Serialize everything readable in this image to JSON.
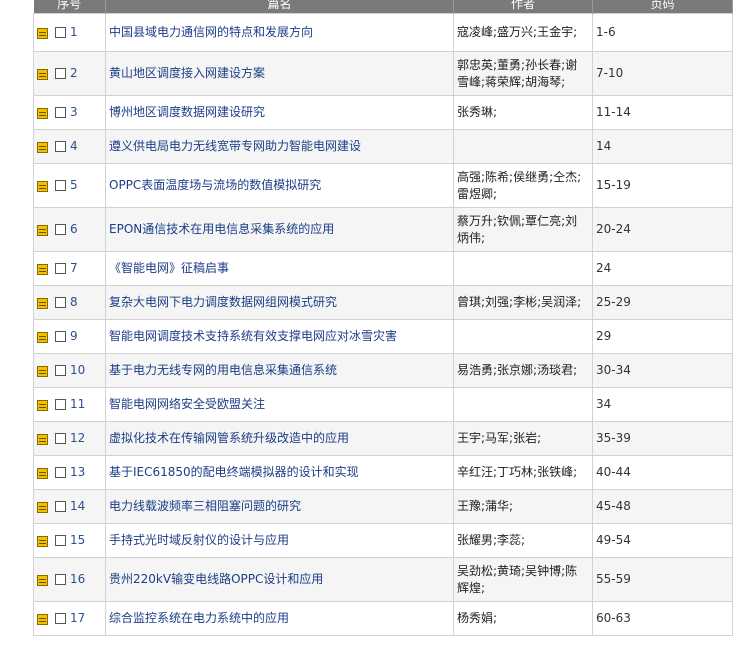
{
  "table": {
    "headers": [
      "序号",
      "篇名",
      "作者",
      "页码"
    ],
    "rows": [
      {
        "num": "1",
        "title": "中国县域电力通信网的特点和发展方向",
        "authors": "寇凌峰;盛万兴;王金宇;",
        "pages": "1-6"
      },
      {
        "num": "2",
        "title": "黄山地区调度接入网建设方案",
        "authors": "郭忠英;董勇;孙长春;谢雪峰;蒋荣辉;胡海琴;",
        "pages": "7-10"
      },
      {
        "num": "3",
        "title": "博州地区调度数据网建设研究",
        "authors": "张秀琳;",
        "pages": "11-14"
      },
      {
        "num": "4",
        "title": "遵义供电局电力无线宽带专网助力智能电网建设",
        "authors": "",
        "pages": "14"
      },
      {
        "num": "5",
        "title": "OPPC表面温度场与流场的数值模拟研究",
        "authors": "高强;陈希;侯继勇;仝杰;雷煜卿;",
        "pages": "15-19"
      },
      {
        "num": "6",
        "title": "EPON通信技术在用电信息采集系统的应用",
        "authors": "蔡万升;钦佩;覃仁亮;刘炳伟;",
        "pages": "20-24"
      },
      {
        "num": "7",
        "title": "《智能电网》征稿启事",
        "authors": "",
        "pages": "24"
      },
      {
        "num": "8",
        "title": "复杂大电网下电力调度数据网组网模式研究",
        "authors": "曾琪;刘强;李彬;吴润泽;",
        "pages": "25-29"
      },
      {
        "num": "9",
        "title": "智能电网调度技术支持系统有效支撑电网应对冰雪灾害",
        "authors": "",
        "pages": "29"
      },
      {
        "num": "10",
        "title": "基于电力无线专网的用电信息采集通信系统",
        "authors": "易浩勇;张京娜;汤琰君;",
        "pages": "30-34"
      },
      {
        "num": "11",
        "title": "智能电网网络安全受欧盟关注",
        "authors": "",
        "pages": "34"
      },
      {
        "num": "12",
        "title": "虚拟化技术在传输网管系统升级改造中的应用",
        "authors": "王宇;马军;张岩;",
        "pages": "35-39"
      },
      {
        "num": "13",
        "title": "基于IEC61850的配电终端模拟器的设计和实现",
        "authors": "辛红汪;丁巧林;张铁峰;",
        "pages": "40-44"
      },
      {
        "num": "14",
        "title": "电力线载波频率三相阻塞问题的研究",
        "authors": "王豫;蒲华;",
        "pages": "45-48"
      },
      {
        "num": "15",
        "title": "手持式光时域反射仪的设计与应用",
        "authors": "张耀男;李蕊;",
        "pages": "49-54"
      },
      {
        "num": "16",
        "title": "贵州220kV输变电线路OPPC设计和应用",
        "authors": "吴劲松;黄琦;吴钟博;陈辉煌;",
        "pages": "55-59"
      },
      {
        "num": "17",
        "title": "综合监控系统在电力系统中的应用",
        "authors": "杨秀娟;",
        "pages": "60-63"
      }
    ]
  }
}
